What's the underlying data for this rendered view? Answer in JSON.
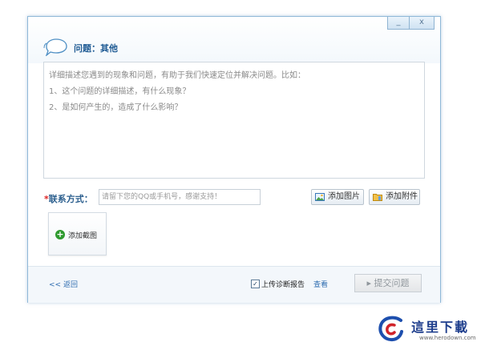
{
  "window": {
    "minimize": "_",
    "close": "x",
    "title": "问题：其他"
  },
  "description": {
    "lines": [
      "详细描述您遇到的现象和问题，有助于我们快速定位并解决问题。比如：",
      "1、这个问题的详细描述，有什么现象？",
      "2、是如何产生的，造成了什么影响？"
    ]
  },
  "contact": {
    "required_mark": "*",
    "label": "联系方式：",
    "placeholder": "请留下您的QQ或手机号，感谢支持！"
  },
  "toolbar": {
    "add_image": "添加图片",
    "add_attachment": "添加附件",
    "add_screenshot": "添加截图"
  },
  "footer": {
    "back": "<< 返回",
    "upload_report_checked": true,
    "check_mark": "✓",
    "upload_report": "上传诊断报告",
    "view": "查看",
    "submit_arrow": "▸",
    "submit": "提交问题"
  },
  "watermark": {
    "brand": "這里下載",
    "url": "www.herodown.com"
  },
  "colors": {
    "title": "#1f5b94",
    "link": "#2f6db0",
    "required": "#dd2222",
    "border": "#8fb8d8"
  }
}
